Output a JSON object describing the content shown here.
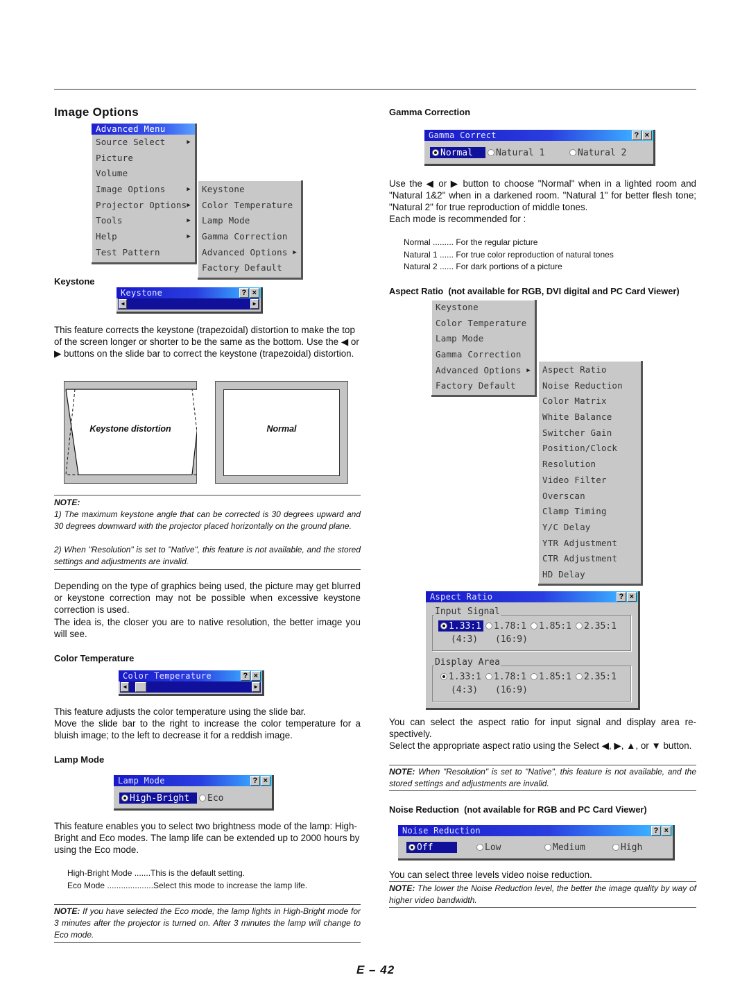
{
  "section_title": "Image Options",
  "advanced_menu": {
    "title": "Advanced Menu",
    "items": [
      {
        "label": "Source Select",
        "submenu": true
      },
      {
        "label": "Picture",
        "submenu": false
      },
      {
        "label": "Volume",
        "submenu": false
      },
      {
        "label": "Image Options",
        "submenu": true
      },
      {
        "label": "Projector Options",
        "submenu": true
      },
      {
        "label": "Tools",
        "submenu": true
      },
      {
        "label": "Help",
        "submenu": true
      },
      {
        "label": "Test Pattern",
        "submenu": false
      }
    ]
  },
  "image_options_menu": {
    "items": [
      {
        "label": "Keystone",
        "submenu": false
      },
      {
        "label": "Color Temperature",
        "submenu": false
      },
      {
        "label": "Lamp Mode",
        "submenu": false
      },
      {
        "label": "Gamma Correction",
        "submenu": false
      },
      {
        "label": "Advanced Options",
        "submenu": true
      },
      {
        "label": "Factory Default",
        "submenu": false
      }
    ]
  },
  "keystone": {
    "heading": "Keystone",
    "window_title": "Keystone",
    "help_btn": "?",
    "close_btn": "×",
    "description": "This feature corrects the keystone (trapezoidal) distortion to make the top of the screen longer or shorter to be the same as the bottom. Use the ◀ or ▶ buttons on the slide bar to correct the keystone (trapezoidal) distortion.",
    "diagram_distorted_label": "Keystone distortion",
    "diagram_normal_label": "Normal",
    "note_label": "NOTE:",
    "note_1": "1) The maximum keystone angle that can be corrected is 30 degrees upward and 30 degrees downward with the projector placed horizontally on the ground plane.",
    "note_2": "2) When \"Resolution\" is set to \"Native\", this feature is not available, and the stored settings and adjustments are invalid.",
    "para_1": "Depending on the type of graphics being used, the picture may get blurred or keystone correction may not be possible when excessive keystone correction is used.",
    "para_2": "The idea is, the closer you are to native resolution, the better image you will see."
  },
  "color_temperature": {
    "heading": "Color Temperature",
    "window_title": "Color Temperature",
    "slider_position": 0.05,
    "para_1": "This feature adjusts the color temperature using the slide bar.",
    "para_2": "Move the slide bar to the right to increase the color temperature for a bluish image; to the left to decrease it for a reddish image."
  },
  "lamp_mode": {
    "heading": "Lamp Mode",
    "window_title": "Lamp Mode",
    "options": [
      {
        "label": "High-Bright",
        "selected": true
      },
      {
        "label": "Eco",
        "selected": false
      }
    ],
    "description": "This feature enables you to select two brightness mode of the lamp: High-Bright and Eco modes. The lamp life can be extended up to 2000 hours by using the Eco mode.",
    "list": [
      {
        "term": "High-Bright Mode",
        "dots": " .......",
        "def": "This is the default setting."
      },
      {
        "term": "Eco Mode",
        "dots": " ....................",
        "def": "Select this mode to increase the lamp life."
      }
    ],
    "note_label": "NOTE:",
    "note": " If you have selected the Eco mode, the lamp lights in High-Bright mode for 3 minutes after the projector is turned on. After 3 minutes the lamp will change to Eco mode."
  },
  "gamma_correction": {
    "heading": "Gamma Correction",
    "window_title": "Gamma Correct",
    "options": [
      {
        "label": "Normal",
        "selected": true
      },
      {
        "label": "Natural 1",
        "selected": false
      },
      {
        "label": "Natural 2",
        "selected": false
      }
    ],
    "description": "Use the ◀ or ▶ button to choose \"Normal\" when in a lighted room and \"Natural 1&2\" when in a darkened room. \"Natural 1\" for better flesh tone; \"Natural 2\" for true reproduction of middle tones.",
    "each_mode": "Each mode is recommended for :",
    "list": [
      {
        "term": "Normal",
        "dots": " .........",
        "def": " For the regular picture"
      },
      {
        "term": "Natural 1",
        "dots": " ......",
        "def": " For true color reproduction of natural tones"
      },
      {
        "term": "Natural 2",
        "dots": " ......",
        "def": " For dark portions of a picture"
      }
    ]
  },
  "aspect_ratio": {
    "heading": "Aspect Ratio",
    "heading_note": "(not available for RGB, DVI digital and PC Card Viewer)",
    "image_options_items": [
      {
        "label": "Keystone",
        "submenu": false
      },
      {
        "label": "Color Temperature",
        "submenu": false
      },
      {
        "label": "Lamp Mode",
        "submenu": false
      },
      {
        "label": "Gamma Correction",
        "submenu": false
      },
      {
        "label": "Advanced Options",
        "submenu": true
      },
      {
        "label": "Factory Default",
        "submenu": false
      }
    ],
    "advanced_options_items": [
      "Aspect Ratio",
      "Noise Reduction",
      "Color Matrix",
      "White Balance",
      "Switcher Gain",
      "Position/Clock",
      "Resolution",
      "Video Filter",
      "Overscan",
      "Clamp Timing",
      "Y/C Delay",
      "YTR Adjustment",
      "CTR Adjustment",
      "HD Delay"
    ],
    "window_title": "Aspect Ratio",
    "input_signal_label": "Input Signal",
    "display_area_label": "Display Area",
    "ratios": [
      "1.33:1",
      "1.78:1",
      "1.85:1",
      "2.35:1"
    ],
    "sub_labels": [
      "(4:3)",
      "(16:9)"
    ],
    "input_selected": 0,
    "display_selected": 0,
    "para_1": "You can select the aspect ratio for input signal and display area re-spectively.",
    "para_2": "Select the appropriate aspect ratio using the Select ◀, ▶, ▲, or ▼ button.",
    "note_label": "NOTE:",
    "note": " When \"Resolution\" is set to \"Native\", this feature is not available, and the stored settings and adjustments are invalid."
  },
  "noise_reduction": {
    "heading": "Noise Reduction",
    "heading_note": "(not available for RGB and PC Card Viewer)",
    "window_title": "Noise Reduction",
    "options": [
      {
        "label": "Off",
        "selected": true
      },
      {
        "label": "Low",
        "selected": false
      },
      {
        "label": "Medium",
        "selected": false
      },
      {
        "label": "High",
        "selected": false
      }
    ],
    "description": "You can select three levels video noise reduction.",
    "note_label": "NOTE:",
    "note": " The lower the Noise Reduction level, the better the image quality by way of higher video bandwidth."
  },
  "page_number": "E – 42"
}
